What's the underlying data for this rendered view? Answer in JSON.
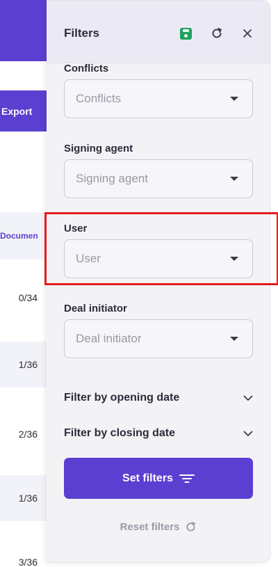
{
  "background": {
    "export_label": "Export",
    "column_header": "Documen",
    "rows": [
      "0/34",
      "1/36",
      "2/36",
      "1/36",
      "3/36"
    ]
  },
  "panel": {
    "title": "Filters",
    "header_icons": [
      "save-icon",
      "refresh-icon",
      "close-icon"
    ],
    "fields": [
      {
        "label": "Conflicts",
        "placeholder": "Conflicts"
      },
      {
        "label": "Signing agent",
        "placeholder": "Signing agent"
      },
      {
        "label": "User",
        "placeholder": "User"
      },
      {
        "label": "Deal initiator",
        "placeholder": "Deal initiator"
      }
    ],
    "collapsibles": [
      {
        "label": "Filter by opening date"
      },
      {
        "label": "Filter by closing date"
      }
    ],
    "set_filters_label": "Set filters",
    "reset_filters_label": "Reset filters"
  },
  "colors": {
    "accent": "#5b3fd1",
    "save_green": "#1fa160",
    "highlight": "#e61a1a"
  }
}
